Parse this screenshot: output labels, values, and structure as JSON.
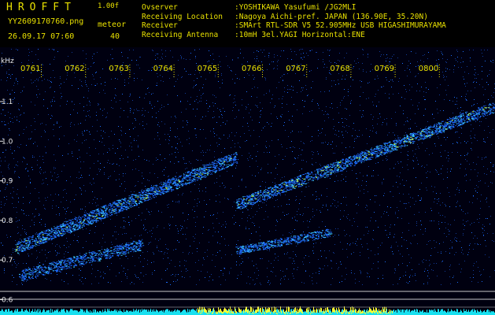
{
  "header": {
    "app_name": "HROFFT",
    "version": "1.00f",
    "filename": "YY2609170760.png",
    "meteor_label": "meteor",
    "meteor_count": "40",
    "datetime": "26.09.17 07:60"
  },
  "info": [
    {
      "label": "Ovserver",
      "value": ":YOSHIKAWA Yasufumi /JG2MLI"
    },
    {
      "label": "Receiving Location",
      "value": ":Nagoya Aichi-pref. JAPAN (136.90E, 35.20N)"
    },
    {
      "label": "Receiver",
      "value": ":SMArt RTL-SDR V5 52.905MHz USB HIGASHIMURAYAMA"
    },
    {
      "label": "Receiving Antenna",
      "value": ":10mH 3el.YAGI Horizontal:ENE"
    }
  ],
  "spectrogram": {
    "unit_label": "kHz",
    "time_ticks": [
      "0761",
      "0762",
      "0763",
      "0764",
      "0765",
      "0766",
      "0767",
      "0768",
      "0769",
      "0800"
    ],
    "freq_ticks": [
      "1.1",
      "1.0",
      "0.9",
      "0.8",
      "0.7",
      "0.6"
    ],
    "colors": {
      "background": "#000010",
      "signal": "#1d6cff",
      "strong": "#3fd0ff",
      "peak": "#c8ff40",
      "level_cyan": "#18e0f0",
      "level_yellow": "#ffff30",
      "grid": "#c8c8c8"
    }
  }
}
